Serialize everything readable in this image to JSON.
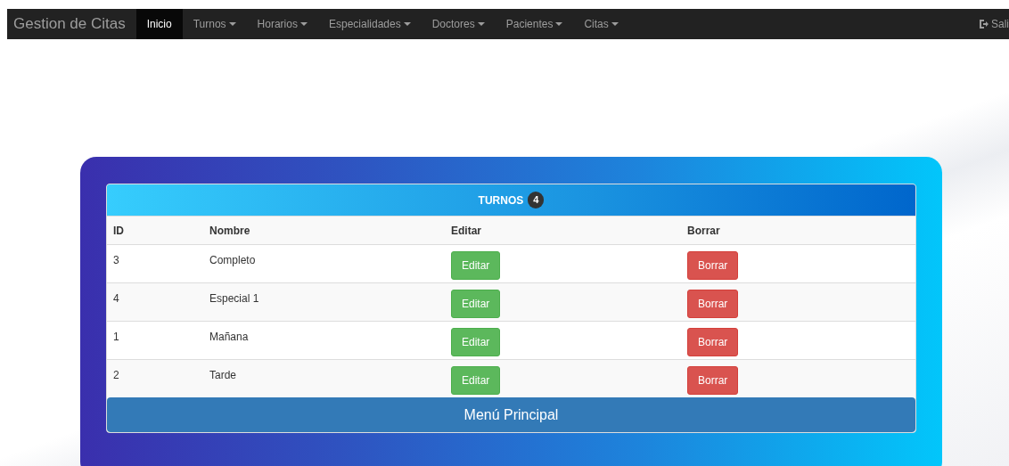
{
  "navbar": {
    "brand": "Gestion de Citas",
    "items": [
      {
        "label": "Inicio",
        "dropdown": false,
        "selected": true
      },
      {
        "label": "Turnos",
        "dropdown": true,
        "selected": false
      },
      {
        "label": "Horarios",
        "dropdown": true,
        "selected": false
      },
      {
        "label": "Especialidades",
        "dropdown": true,
        "selected": false
      },
      {
        "label": "Doctores",
        "dropdown": true,
        "selected": false
      },
      {
        "label": "Pacientes",
        "dropdown": true,
        "selected": false
      },
      {
        "label": "Citas",
        "dropdown": true,
        "selected": false
      }
    ],
    "logout": "Sali"
  },
  "panel": {
    "title": "TURNOS",
    "count": "4",
    "columns": [
      "ID",
      "Nombre",
      "Editar",
      "Borrar"
    ],
    "rows": [
      {
        "id": "3",
        "nombre": "Completo",
        "edit": "Editar",
        "delete": "Borrar"
      },
      {
        "id": "4",
        "nombre": "Especial 1",
        "edit": "Editar",
        "delete": "Borrar"
      },
      {
        "id": "1",
        "nombre": "Mañana",
        "edit": "Editar",
        "delete": "Borrar"
      },
      {
        "id": "2",
        "nombre": "Tarde",
        "edit": "Editar",
        "delete": "Borrar"
      }
    ],
    "footer_button": "Menú Principal"
  }
}
